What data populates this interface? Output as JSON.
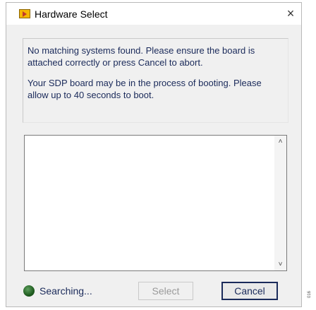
{
  "window": {
    "title": "Hardware Select",
    "close_glyph": "×"
  },
  "message": {
    "line1": "No matching systems found. Please ensure the board is attached correctly or press Cancel to abort.",
    "line2": "Your SDP board may be in the process of booting. Please allow up to 40 seconds to boot."
  },
  "listbox": {
    "scroll_up_glyph": "˄",
    "scroll_down_glyph": "˅"
  },
  "status": {
    "label": "Searching...",
    "indicator_color": "#2e6b2e"
  },
  "buttons": {
    "select_label": "Select",
    "cancel_label": "Cancel"
  },
  "side_note": "016"
}
